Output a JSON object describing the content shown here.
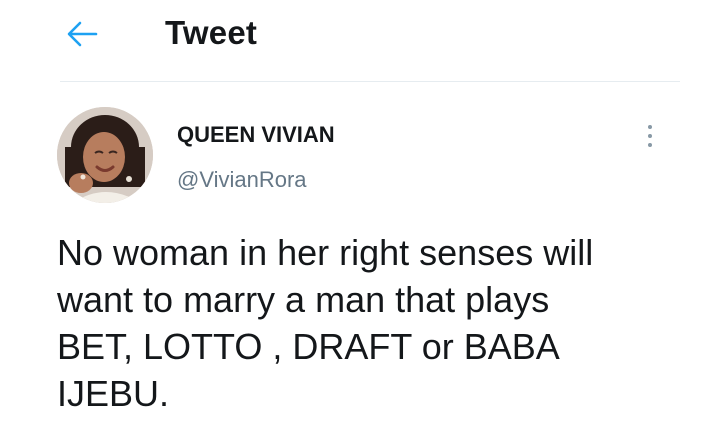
{
  "header": {
    "title": "Tweet",
    "back_icon": "arrow-left-icon",
    "accent_color": "#1da1f2"
  },
  "tweet": {
    "author": {
      "display_name": "QUEEN VIVIAN",
      "handle": "@VivianRora",
      "avatar_icon": "profile-photo"
    },
    "more_icon": "more-vertical-icon",
    "lines": [
      "No woman in her right senses will",
      "want to marry a man that plays",
      "BET, LOTTO , DRAFT or BABA",
      "IJEBU."
    ]
  }
}
